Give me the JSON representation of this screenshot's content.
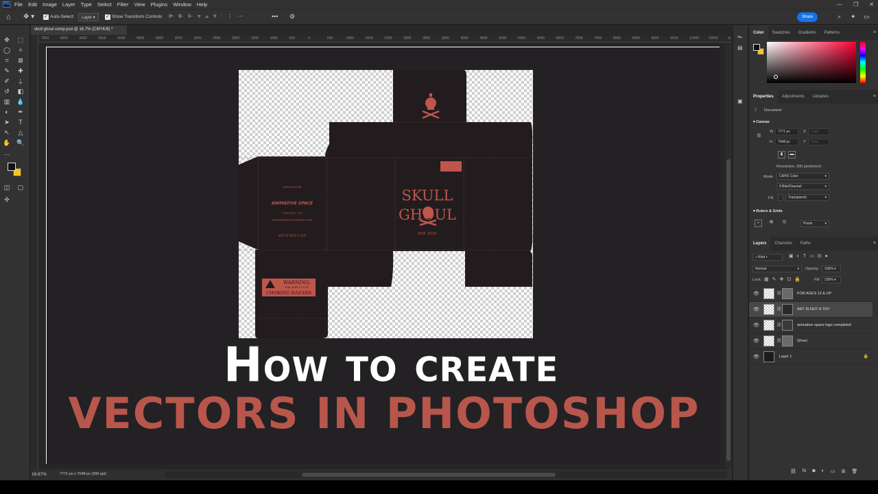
{
  "menubar": {
    "logo": "Ps",
    "items": [
      "File",
      "Edit",
      "Image",
      "Layer",
      "Type",
      "Select",
      "Filter",
      "View",
      "Plugins",
      "Window",
      "Help"
    ],
    "window_controls": [
      "—",
      "❐",
      "✕"
    ]
  },
  "options_bar": {
    "auto_select_label": "Auto-Select:",
    "auto_select_target": "Layer",
    "show_transform_label": "Show Transform Controls",
    "more_label": "•••",
    "share_label": "Share"
  },
  "document": {
    "tab_title": "skull ghoul comp.psd @ 16.7% (CMYK/8) *",
    "ruler_ticks": [
      "7000",
      "6500",
      "6000",
      "5500",
      "5000",
      "4500",
      "4000",
      "3500",
      "3000",
      "2500",
      "2000",
      "1500",
      "1000",
      "500",
      "0",
      "500",
      "1000",
      "1500",
      "2000",
      "2500",
      "3000",
      "3500",
      "4000",
      "4500",
      "5000",
      "5500",
      "6000",
      "6500",
      "7000",
      "7500",
      "8000",
      "8500",
      "9000",
      "9500",
      "10000",
      "10500",
      "11000",
      "11500"
    ],
    "zoom": "16.67%",
    "dimensions": "7771 px x 7048 px (300 ppi)"
  },
  "artwork": {
    "brand_title_1": "SKULL",
    "brand_title_2": "GHOUL",
    "est": "EST 2025",
    "designed_by": "DESIGNED BY",
    "studio": "ANIMATIVE SPACE",
    "city": "TORONTO , ON",
    "website": "WWW.ANIMATIVESPACE.SHOP",
    "art_not_toy": "ART IS NOT A TOY",
    "warning_title": "WARNING:",
    "warning_sub": "FOR AGES 12 & UP",
    "warning_hazard": "CHOKING HAZARD",
    "accent_color": "#b8564c",
    "box_color": "#231c1e"
  },
  "headline": {
    "line1": "How to create",
    "line2": "VECTORS IN PHOTOSHOP"
  },
  "color_panel": {
    "tabs": [
      "Color",
      "Swatches",
      "Gradients",
      "Patterns"
    ],
    "foreground": "#111111",
    "background": "#f7c51d"
  },
  "properties_panel": {
    "tabs": [
      "Properties",
      "Adjustments",
      "Libraries"
    ],
    "doc_label": "Document",
    "canvas_section": "Canvas",
    "w_label": "W",
    "w_value": "7771 px",
    "h_label": "H",
    "h_value": "7048 px",
    "x_label": "X",
    "y_label": "Y",
    "x_value": "0 px",
    "y_value": "0 px",
    "resolution": "Resolution: 300 pixels/inch",
    "mode_label": "Mode",
    "mode_value": "CMYK Color",
    "bits_value": "8 Bits/Channel",
    "fill_label": "Fill",
    "fill_value": "Transparent",
    "rulers_section": "Rulers & Grids",
    "units_value": "Pixels"
  },
  "layers_panel": {
    "tabs": [
      "Layers",
      "Channels",
      "Paths"
    ],
    "kind_label": "Kind",
    "blend_mode": "Normal",
    "opacity_label": "Opacity:",
    "opacity_value": "100%",
    "lock_label": "Lock:",
    "fill_label": "Fill:",
    "fill_value": "100%",
    "layers": [
      {
        "name": "FOR AGES 12 & UP",
        "selected": false
      },
      {
        "name": "ART IS NOT A TOY",
        "selected": true
      },
      {
        "name": "animative space logo completed",
        "selected": false
      },
      {
        "name": "Ghoul",
        "selected": false
      },
      {
        "name": "Layer 1",
        "selected": false,
        "locked": true
      }
    ],
    "footer_icons": [
      "link-icon",
      "fx-icon",
      "mask-icon",
      "adjustment-icon",
      "group-icon",
      "new-layer-icon",
      "trash-icon"
    ]
  }
}
